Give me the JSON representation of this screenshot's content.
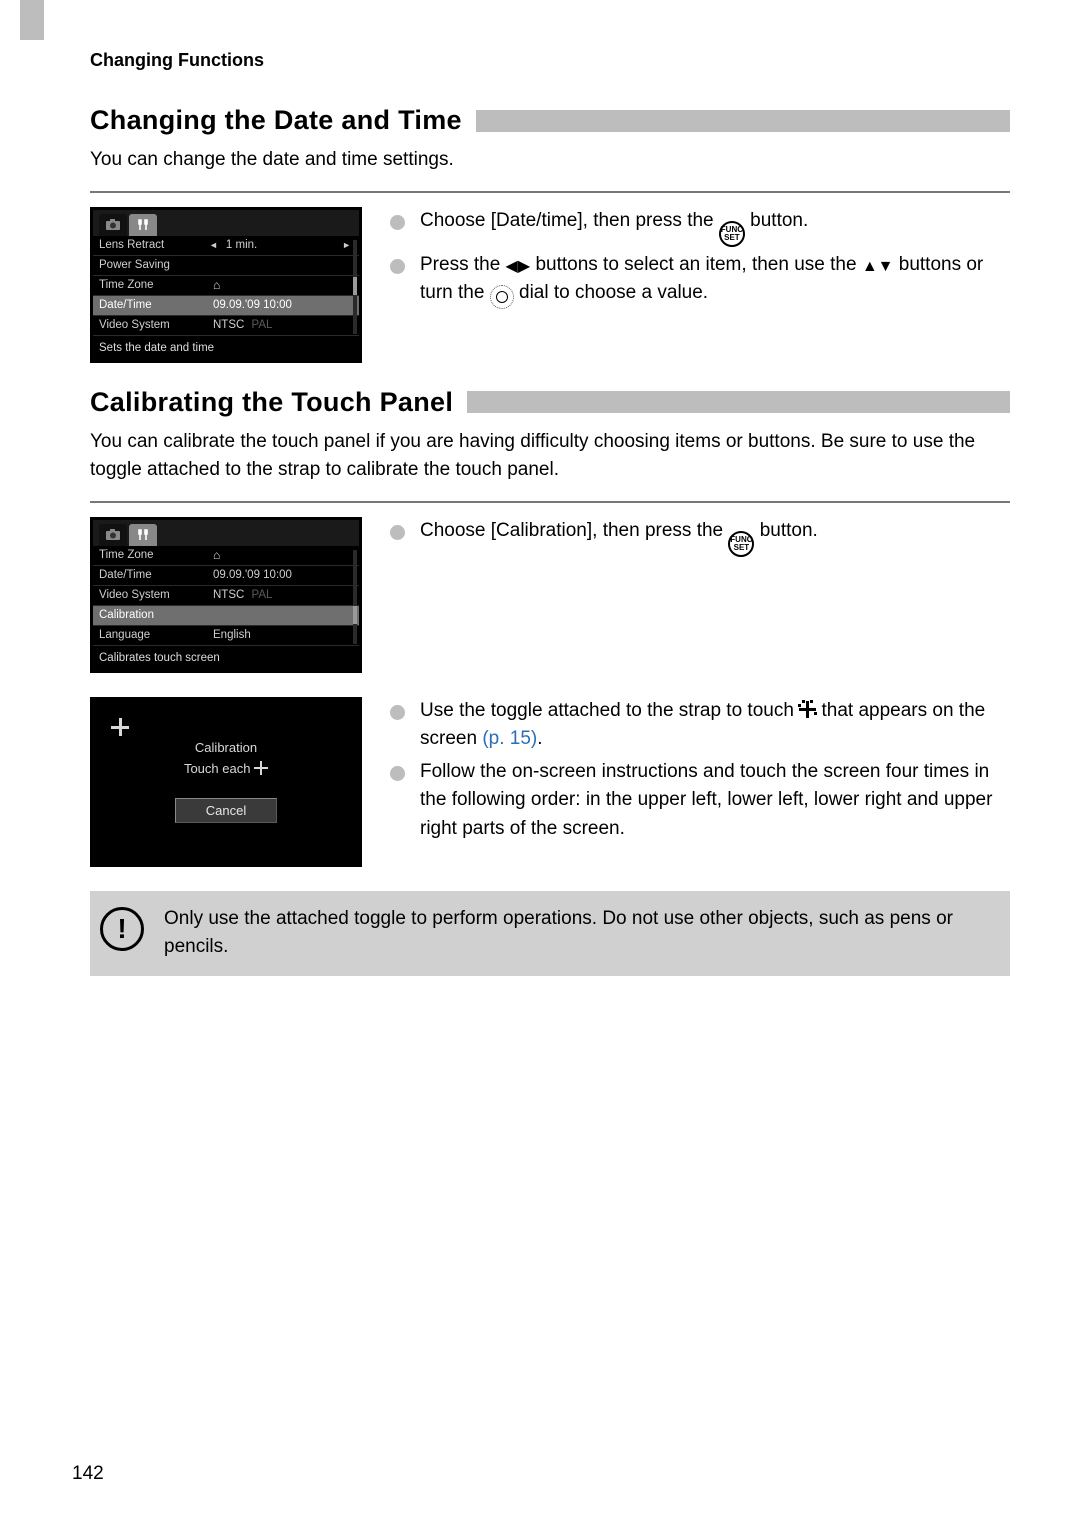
{
  "header": "Changing Functions",
  "section1": {
    "title": "Changing the Date and Time",
    "intro": "You can change the date and time settings.",
    "bullets": [
      "Choose [Date/time], then press the",
      "button.",
      "Press the",
      "buttons to select an item, then use the",
      "buttons or turn the",
      "dial to choose a value."
    ],
    "screenshot": {
      "rows": [
        {
          "label": "Lens Retract",
          "value": "1 min."
        },
        {
          "label": "Power Saving",
          "value": ""
        },
        {
          "label": "Time Zone",
          "value": ""
        },
        {
          "label": "Date/Time",
          "value": "09.09.'09 10:00"
        },
        {
          "label": "Video System",
          "value": "NTSC",
          "alt": "PAL"
        }
      ],
      "footer": "Sets the date and time"
    }
  },
  "section2": {
    "title": "Calibrating the Touch Panel",
    "intro": "You can calibrate the touch panel if you are having difficulty choosing items or buttons. Be sure to use the toggle attached to the strap to calibrate the touch panel.",
    "bullets1": [
      "Choose [Calibration], then press the",
      "button."
    ],
    "screenshot1": {
      "rows": [
        {
          "label": "Time Zone",
          "value": ""
        },
        {
          "label": "Date/Time",
          "value": "09.09.'09 10:00"
        },
        {
          "label": "Video System",
          "value": "NTSC",
          "alt": "PAL"
        },
        {
          "label": "Calibration",
          "value": ""
        },
        {
          "label": "Language",
          "value": "English"
        }
      ],
      "footer": "Calibrates touch screen"
    },
    "screenshot2": {
      "line1": "Calibration",
      "line2": "Touch each",
      "cancel": "Cancel"
    },
    "bullets2": {
      "b1a": "Use the toggle attached to the strap to touch",
      "b1b": "that appears on the screen",
      "b1_link": "(p. 15)",
      "b2": "Follow the on-screen instructions and touch the screen four times in the following order: in the upper left, lower left, lower right and upper right parts of the screen."
    }
  },
  "warning": "Only use the attached toggle to perform operations. Do not use other objects, such as pens or pencils.",
  "page_number": "142",
  "icons": {
    "func_top": "FUNC",
    "func_bot": "SET"
  }
}
